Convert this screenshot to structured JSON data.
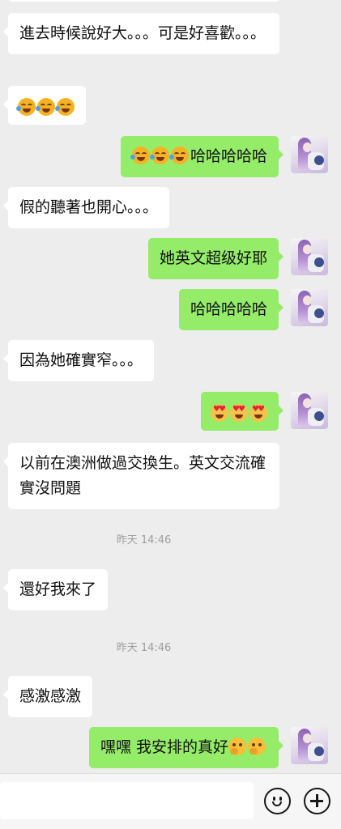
{
  "messages": [
    {
      "text": "進去時候說好大。。。可是好喜歡。。。"
    },
    {
      "text": ""
    },
    {
      "text": "哈哈哈哈哈"
    },
    {
      "text": "假的聽著也開心。。。"
    },
    {
      "text": "她英文超级好耶"
    },
    {
      "text": "哈哈哈哈哈"
    },
    {
      "text": "因為她確實窄。。。"
    },
    {
      "text": ""
    },
    {
      "text": "以前在澳洲做過交換生。英文交流確實沒問題"
    },
    {
      "text": "還好我來了"
    },
    {
      "text": "感激感激"
    },
    {
      "text": "嘿嘿 我安排的真好"
    }
  ],
  "timestamps": [
    "昨天 14:46",
    "昨天 14:46"
  ],
  "emoji": {
    "laugh": "face-with-tears-of-joy",
    "heart_eyes": "smiling-face-with-heart-eyes",
    "thinking": "face-with-hand-over-mouth"
  },
  "colors": {
    "background": "#ededed",
    "incoming_bubble": "#ffffff",
    "outgoing_bubble": "#95ec69",
    "timestamp_text": "#9e9e9e"
  },
  "input": {
    "value": "",
    "placeholder": ""
  }
}
